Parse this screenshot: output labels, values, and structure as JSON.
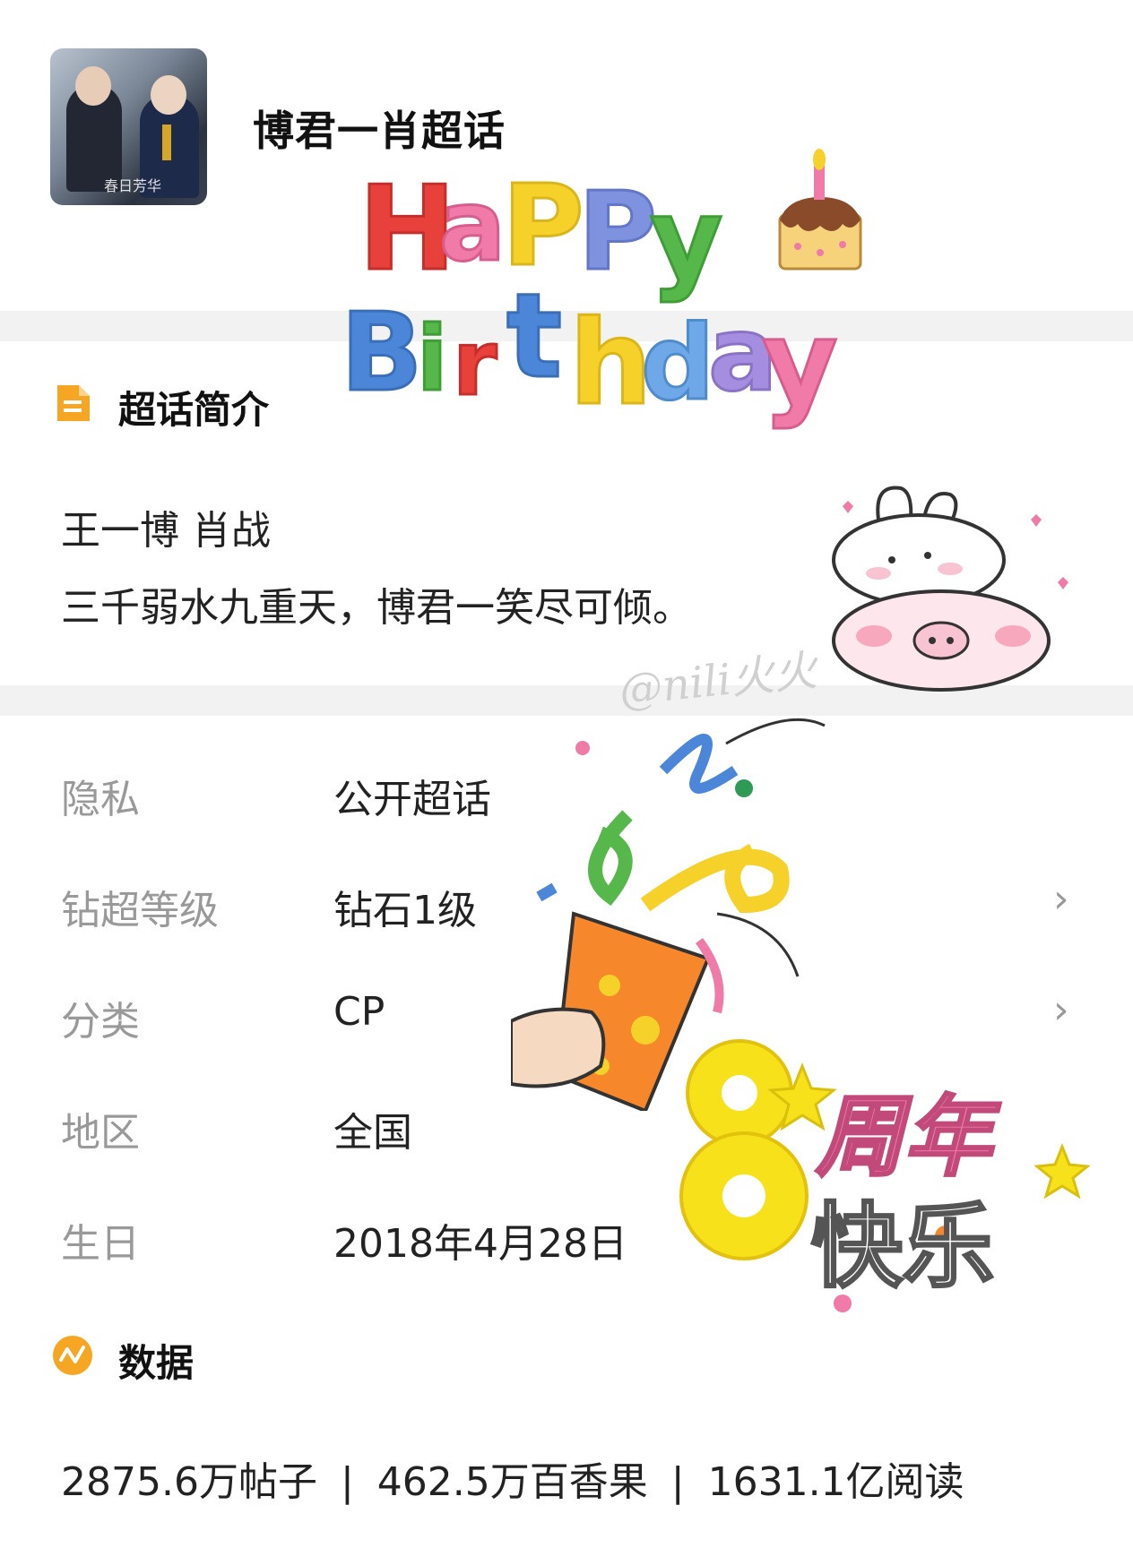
{
  "header": {
    "title": "博君一肖超话",
    "avatar_caption": "春日芳华"
  },
  "intro": {
    "section_title": "超话简介",
    "icon": "document-icon",
    "line1": "王一博 肖战",
    "line2": "三千弱水九重天，博君一笑尽可倾。"
  },
  "info": {
    "rows": [
      {
        "label": "隐私",
        "value": "公开超话",
        "has_arrow": false
      },
      {
        "label": "钻超等级",
        "value": "钻石1级",
        "has_arrow": true
      },
      {
        "label": "分类",
        "value": "CP",
        "has_arrow": true
      },
      {
        "label": "地区",
        "value": "全国",
        "has_arrow": false
      },
      {
        "label": "生日",
        "value": "2018年4月28日",
        "has_arrow": false
      }
    ],
    "arrow_glyph": "›"
  },
  "stats": {
    "section_title": "数据",
    "icon": "chart-icon",
    "posts": "2875.6万帖子",
    "fruits": "462.5万百香果",
    "reads": "1631.1亿阅读",
    "separator": "|"
  },
  "decoration": {
    "happy": "HAPPY",
    "birthday": "Birthday",
    "anniversary_number": "8",
    "anniversary_text1": "周年",
    "anniversary_text2": "快乐",
    "watermark": "@nili火火",
    "colors": {
      "accent_orange": "#f5a623",
      "red": "#e8413c",
      "pink": "#f07aa8",
      "yellow": "#f6d12a",
      "green": "#56b84a",
      "blue": "#4b86d8",
      "purple": "#a58ee0"
    }
  }
}
